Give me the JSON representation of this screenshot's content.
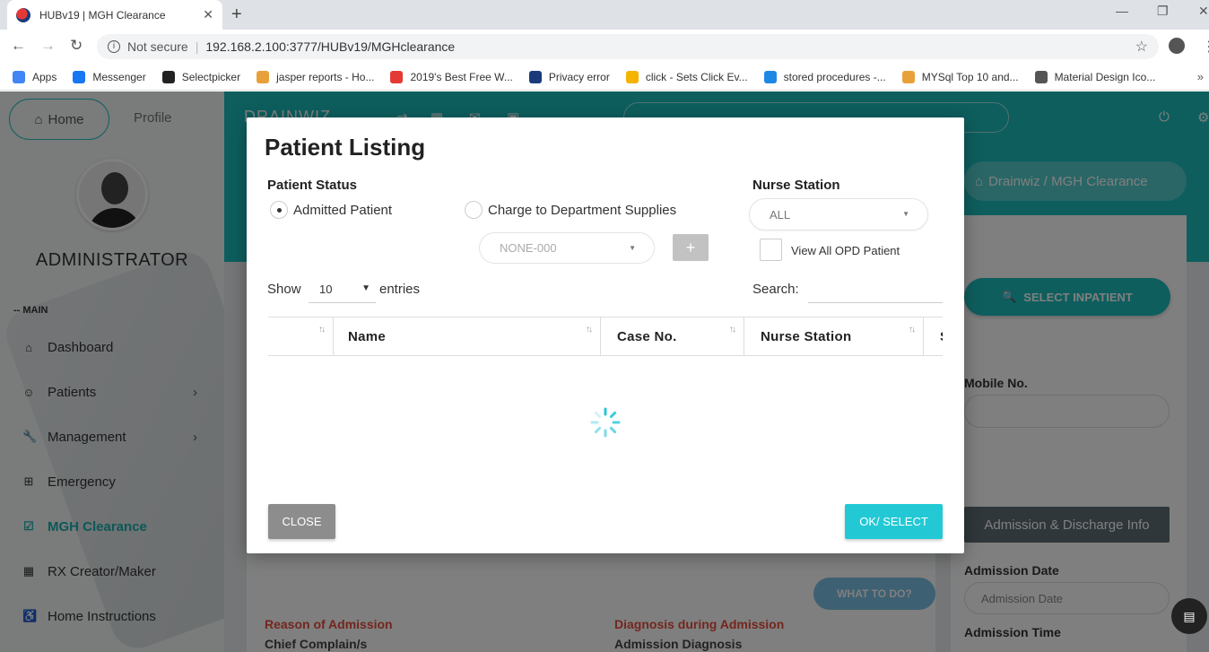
{
  "browser": {
    "tab_title": "HUBv19 | MGH Clearance",
    "tab_close": "✕",
    "new_tab": "+",
    "window_minimize": "—",
    "window_restore": "❐",
    "window_close": "✕",
    "not_secure": "Not secure",
    "url": "192.168.2.100:3777/HUBv19/MGHclearance",
    "bookmarks": [
      {
        "label": "Apps",
        "color": "#4285f4"
      },
      {
        "label": "Messenger",
        "color": "#1877f2"
      },
      {
        "label": "Selectpicker",
        "color": "#222222"
      },
      {
        "label": "jasper reports - Ho...",
        "color": "#e8a13a"
      },
      {
        "label": "2019's Best Free W...",
        "color": "#e53935"
      },
      {
        "label": "Privacy error",
        "color": "#1a3a7a"
      },
      {
        "label": "click - Sets Click Ev...",
        "color": "#f4b400"
      },
      {
        "label": "stored procedures -...",
        "color": "#1e88e5"
      },
      {
        "label": "MYSql Top 10 and...",
        "color": "#e8a13a"
      },
      {
        "label": "Material Design Ico...",
        "color": "#555555"
      }
    ],
    "bookmarks_more": "»"
  },
  "sidebar": {
    "home": "Home",
    "profile": "Profile",
    "admin_name": "ADMINISTRATOR",
    "section": "-- MAIN",
    "items": [
      {
        "label": "Dashboard",
        "icon": "⌂",
        "chev": ""
      },
      {
        "label": "Patients",
        "icon": "☺",
        "chev": "›"
      },
      {
        "label": "Management",
        "icon": "🔧",
        "chev": "›"
      },
      {
        "label": "Emergency",
        "icon": "⊞",
        "chev": ""
      },
      {
        "label": "MGH Clearance",
        "icon": "☑",
        "chev": ""
      },
      {
        "label": "RX Creator/Maker",
        "icon": "▦",
        "chev": ""
      },
      {
        "label": "Home Instructions",
        "icon": "♿",
        "chev": ""
      }
    ]
  },
  "content": {
    "brand": "DRAINWIZ",
    "breadcrumb": "Drainwiz  /  MGH Clearance",
    "select_inpatient": "SELECT INPATIENT",
    "mobile_label": "Mobile No.",
    "admission_tab": "Admission & Discharge Info",
    "admission_date_label": "Admission Date",
    "admission_date_placeholder": "Admission Date",
    "admission_time_label": "Admission Time",
    "what_to_do": "WHAT TO DO?",
    "reason": "Reason of Admission",
    "chief": "Chief Complain/s",
    "diagnosis": "Diagnosis during Admission",
    "admission_diagnosis": "Admission Diagnosis"
  },
  "modal": {
    "title": "Patient Listing",
    "patient_status_label": "Patient Status",
    "radio_admitted": "Admitted Patient",
    "radio_charge": "Charge to Department Supplies",
    "dept_select": "NONE-000",
    "plus": "+",
    "nurse_station_label": "Nurse Station",
    "nurse_station_value": "ALL",
    "view_opd": "View All OPD Patient",
    "show": "Show",
    "entries_value": "10",
    "entries": "entries",
    "search": "Search:",
    "columns": [
      "",
      "Name",
      "Case  No.",
      "Nurse  Station",
      "S"
    ],
    "close": "CLOSE",
    "ok": "OK/ SELECT"
  }
}
